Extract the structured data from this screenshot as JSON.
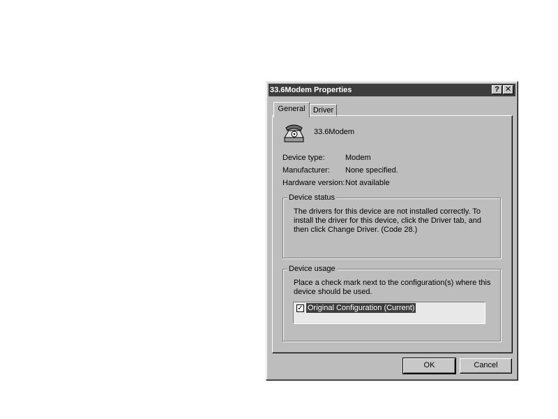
{
  "window": {
    "title": "33.6Modem Properties",
    "help_glyph": "?",
    "close_glyph": "✕"
  },
  "tabs": [
    {
      "label": "General",
      "selected": true
    },
    {
      "label": "Driver",
      "selected": false
    }
  ],
  "device": {
    "name": "33.6Modem",
    "icon": "telephone-icon",
    "fields": [
      {
        "label": "Device type:",
        "value": "Modem"
      },
      {
        "label": "Manufacturer:",
        "value": "None specified."
      },
      {
        "label": "Hardware version:",
        "value": "Not available"
      }
    ]
  },
  "status": {
    "title": "Device status",
    "text": "The drivers for this device are not installed correctly. To\ninstall the driver for this device, click the Driver tab, and\nthen click Change Driver.  (Code 28.)"
  },
  "usage": {
    "title": "Device usage",
    "text": "Place a check mark next to the configuration(s) where this\ndevice should be used.",
    "configs": [
      {
        "label": "Original Configuration  (Current)",
        "checked": true,
        "check_glyph": "✓"
      }
    ]
  },
  "buttons": {
    "ok": "OK",
    "cancel": "Cancel"
  },
  "colors": {
    "face": "#bdbdbd",
    "titlebar": "#3d3d3d",
    "selection": "#3d3d3d"
  }
}
